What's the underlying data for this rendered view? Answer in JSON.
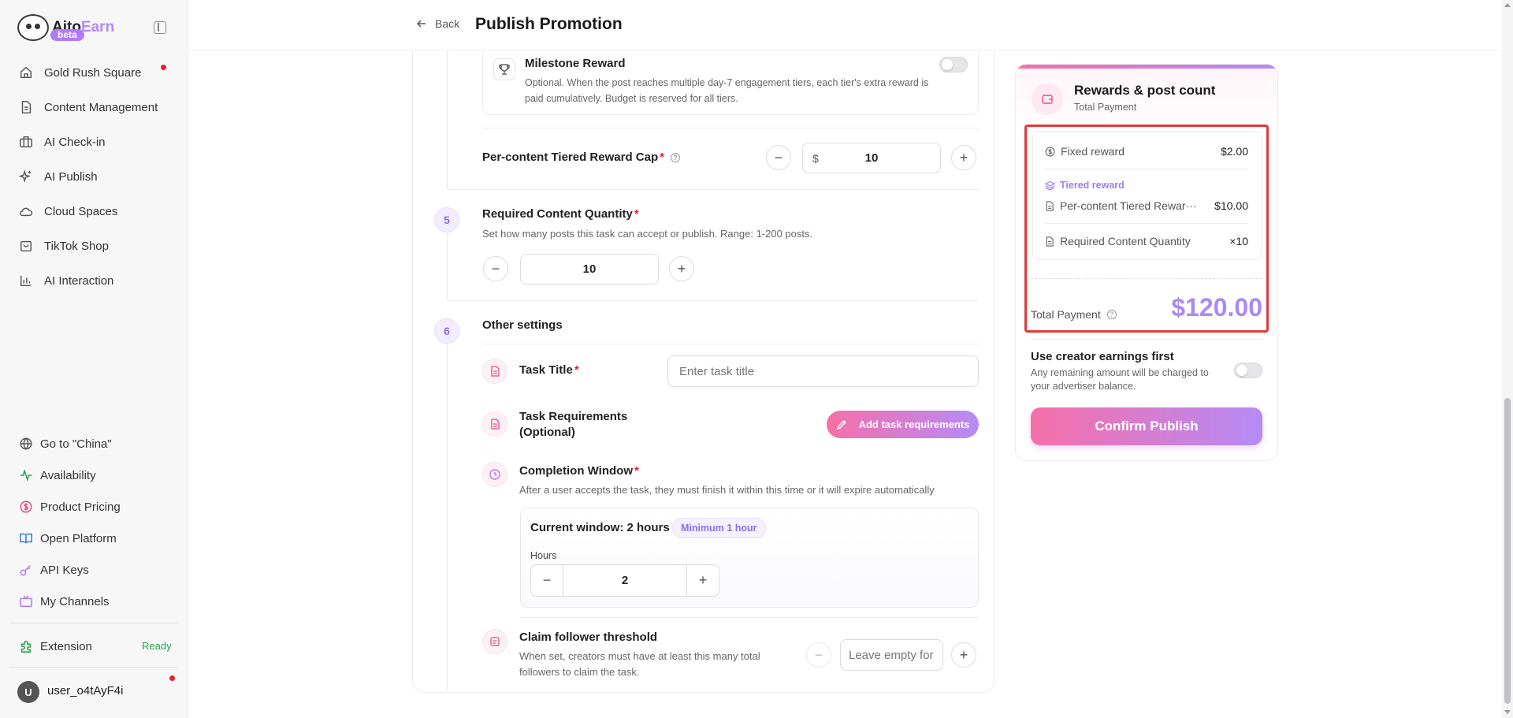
{
  "brand": {
    "name_a": "Aito",
    "name_b": "Earn",
    "badge": "beta"
  },
  "sidebar": {
    "items": [
      {
        "label": "Gold Rush Square",
        "icon": "home-icon",
        "dot": true
      },
      {
        "label": "Content Management",
        "icon": "document-icon"
      },
      {
        "label": "AI Check-in",
        "icon": "briefcase-icon"
      },
      {
        "label": "AI Publish",
        "icon": "sparkle-icon"
      },
      {
        "label": "Cloud Spaces",
        "icon": "cloud-icon"
      },
      {
        "label": "TikTok Shop",
        "icon": "shop-icon"
      },
      {
        "label": "AI Interaction",
        "icon": "bar-chart-icon"
      }
    ],
    "bottom": [
      {
        "label": "Go to \"China\"",
        "icon": "globe-icon"
      },
      {
        "label": "Availability",
        "icon": "activity-icon"
      },
      {
        "label": "Product Pricing",
        "icon": "dollar-circle-icon"
      },
      {
        "label": "Open Platform",
        "icon": "book-icon"
      },
      {
        "label": "API Keys",
        "icon": "key-icon"
      },
      {
        "label": "My Channels",
        "icon": "tv-icon"
      }
    ],
    "extension": {
      "label": "Extension",
      "status": "Ready"
    },
    "user": {
      "initial": "U",
      "name": "user_o4tAyF4i"
    }
  },
  "header": {
    "back": "Back",
    "title": "Publish Promotion"
  },
  "form": {
    "milestone": {
      "title": "Milestone Reward",
      "desc": "Optional. When the post reaches multiple day-7 engagement tiers, each tier's extra reward is paid cumulatively. Budget is reserved for all tiers."
    },
    "tier_cap": {
      "label": "Per-content Tiered Reward Cap",
      "required": "*",
      "currency": "$",
      "value": "10"
    },
    "step5": {
      "num": "5",
      "title": "Required Content Quantity",
      "required": "*",
      "desc": "Set how many posts this task can accept or publish. Range: 1-200 posts.",
      "value": "10"
    },
    "step6": {
      "num": "6",
      "title": "Other settings",
      "task_title": {
        "label": "Task Title",
        "required": "*",
        "placeholder": "Enter task title"
      },
      "task_req": {
        "label_line1": "Task Requirements",
        "label_line2": "(Optional)",
        "button": "Add task requirements"
      },
      "completion": {
        "label": "Completion Window",
        "required": "*",
        "desc": "After a user accepts the task, they must finish it within this time or it will expire automatically",
        "current": "Current window: 2 hours",
        "min_badge": "Minimum 1 hour",
        "hours_label": "Hours",
        "hours_value": "2"
      },
      "follower": {
        "label": "Claim follower threshold",
        "desc": "When set, creators must have at least this many total followers to claim the task.",
        "placeholder": "Leave empty for"
      }
    }
  },
  "summary": {
    "title": "Rewards & post count",
    "subtitle": "Total Payment",
    "fixed_label": "Fixed reward",
    "fixed_value": "$2.00",
    "tiered_label": "Tiered reward",
    "tier_cap_label": "Per-content Tiered Rewar···",
    "tier_cap_value": "$10.00",
    "qty_label": "Required Content Quantity",
    "qty_value": "×10",
    "total_label": "Total Payment",
    "total_value": "$120.00",
    "earnings_title": "Use creator earnings first",
    "earnings_desc": "Any remaining amount will be charged to your advertiser balance.",
    "confirm": "Confirm Publish"
  }
}
